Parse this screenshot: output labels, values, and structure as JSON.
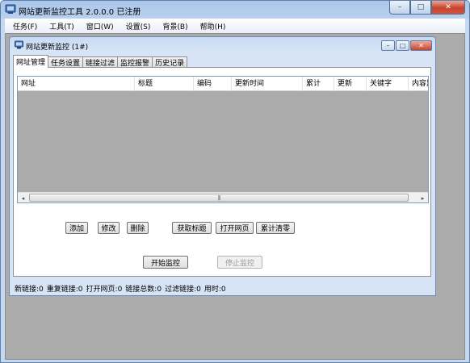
{
  "app": {
    "title": "网站更新监控工具 2.0.0.0  已注册"
  },
  "window_controls": {
    "minimize": "–",
    "maximize": "□",
    "close": "✕"
  },
  "menu": [
    "任务(F)",
    "工具(T)",
    "窗口(W)",
    "设置(S)",
    "背景(B)",
    "帮助(H)"
  ],
  "child_window": {
    "title": "网站更新监控  (1#)",
    "controls": {
      "minimize": "–",
      "maximize": "□",
      "close": "✕"
    }
  },
  "tabs": [
    "网址管理",
    "任务设置",
    "链接过滤",
    "监控报警",
    "历史记录"
  ],
  "table": {
    "columns": [
      "网址",
      "标题",
      "编码",
      "更新时间",
      "累计",
      "更新",
      "关键字",
      "内容监"
    ],
    "rows": []
  },
  "scrollbar": {
    "left_arrow": "◂",
    "right_arrow": "▸",
    "grip": "|||"
  },
  "buttons": {
    "add": "添加",
    "edit": "修改",
    "delete": "删除",
    "fetch_title": "获取标题",
    "open_page": "打开网页",
    "clear_count": "累计清零",
    "start_monitor": "开始监控",
    "stop_monitor": "停止监控"
  },
  "status": {
    "new_links": "新链接:0",
    "dup_links": "重复链接:0",
    "opened_pages": "打开网页:0",
    "total_links": "链接总数:0",
    "filtered_links": "过滤链接:0",
    "elapsed": "用时:0"
  }
}
